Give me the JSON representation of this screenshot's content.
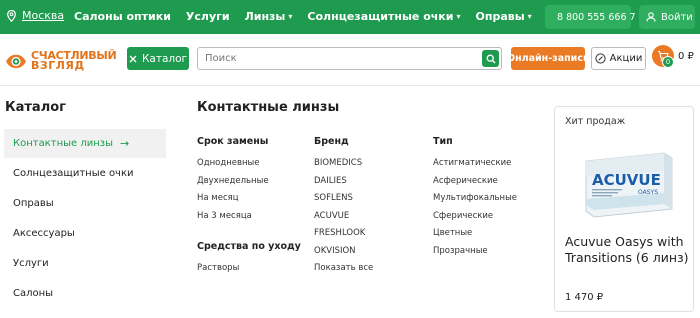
{
  "topbar": {
    "city": "Москва",
    "nav": [
      {
        "label": "Салоны оптики",
        "dropdown": false
      },
      {
        "label": "Услуги",
        "dropdown": false
      },
      {
        "label": "Линзы",
        "dropdown": true
      },
      {
        "label": "Солнцезащитные очки",
        "dropdown": true
      },
      {
        "label": "Оправы",
        "dropdown": true
      }
    ],
    "phone": "8 800 555 666 7",
    "login": "Войти"
  },
  "header": {
    "logo_line1": "СЧАСТЛИВЫЙ",
    "logo_line2": "ВЗГЛЯД",
    "catalog_label": "Каталог",
    "search_placeholder": "Поиск",
    "online_label": "Онлайн-запись",
    "promo_label": "Акции",
    "cart_count": "0",
    "cart_sum": "0 ₽"
  },
  "catalog": {
    "title": "Каталог",
    "items": [
      {
        "label": "Контактные линзы",
        "active": true
      },
      {
        "label": "Солнцезащитные очки",
        "active": false
      },
      {
        "label": "Оправы",
        "active": false
      },
      {
        "label": "Аксессуары",
        "active": false
      },
      {
        "label": "Услуги",
        "active": false
      },
      {
        "label": "Салоны",
        "active": false
      }
    ]
  },
  "submenu": {
    "title": "Контактные линзы",
    "col1": {
      "heading": "Срок замены",
      "links": [
        "Однодневные",
        "Двухнедельные",
        "На месяц",
        "На 3 месяца"
      ],
      "heading2": "Средства по уходу",
      "links2": [
        "Растворы"
      ]
    },
    "col2": {
      "heading": "Бренд",
      "links": [
        "BIOMEDICS",
        "DAILIES",
        "SOFLENS",
        "ACUVUE",
        "FRESHLOOK",
        "OKVISION",
        "Показать все"
      ]
    },
    "col3": {
      "heading": "Тип",
      "links": [
        "Астигматические",
        "Асферические",
        "Мультифокальные",
        "Сферические",
        "Цветные",
        "Прозрачные"
      ]
    }
  },
  "product": {
    "badge": "Хит продаж",
    "brand_on_box": "ACUVUE",
    "sub_on_box": "OASYS",
    "name": "Acuvue Oasys with Transitions (6 линз)",
    "price": "1 470 ₽"
  },
  "colors": {
    "green": "#1e9b4e",
    "orange": "#ea7a23"
  }
}
